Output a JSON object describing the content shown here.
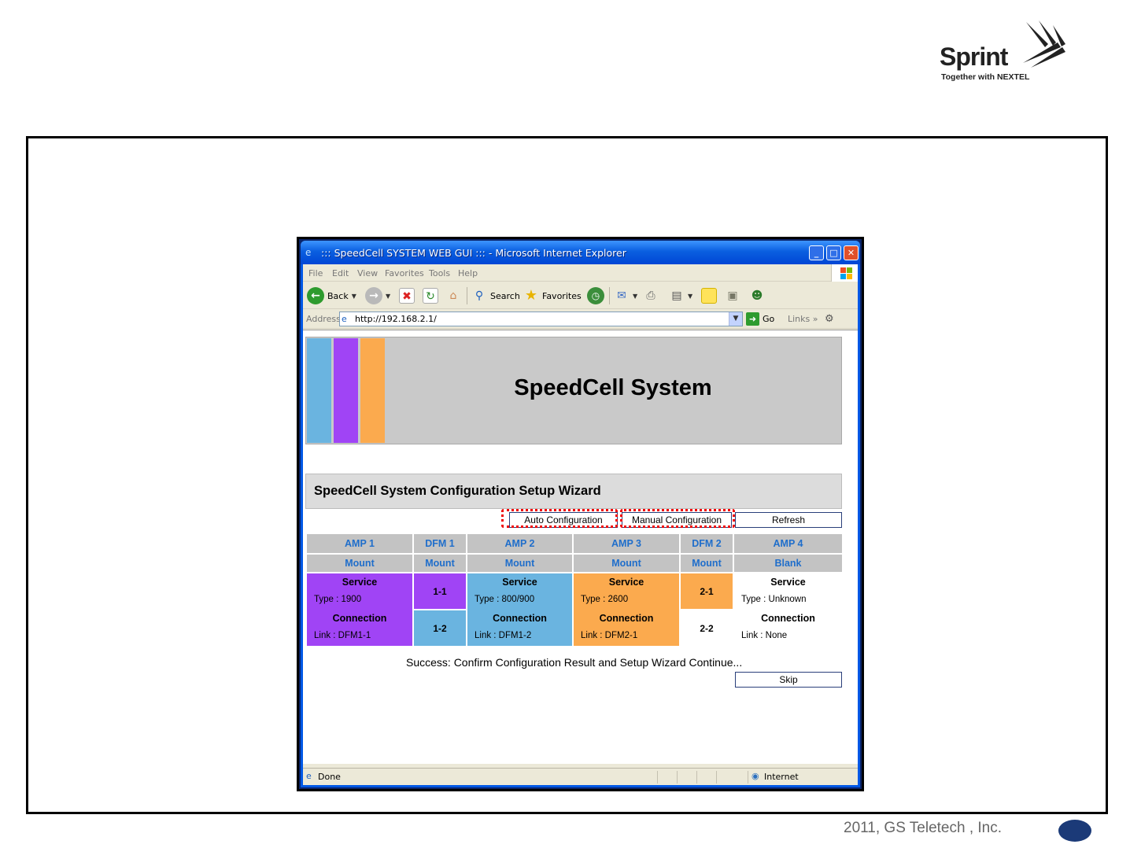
{
  "logo": {
    "brand": "Sprint",
    "tagline": "Together with NEXTEL"
  },
  "footer": {
    "copyright": "2011, GS Teletech , Inc."
  },
  "browser": {
    "title": "::: SpeedCell SYSTEM WEB GUI ::: - Microsoft Internet Explorer",
    "menu": [
      "File",
      "Edit",
      "View",
      "Favorites",
      "Tools",
      "Help"
    ],
    "toolbar": {
      "back": "Back",
      "search": "Search",
      "favorites": "Favorites"
    },
    "address_label": "Address",
    "url": "http://192.168.2.1/",
    "go": "Go",
    "links": "Links",
    "status_left": "Done",
    "status_zone": "Internet"
  },
  "page": {
    "banner_title": "SpeedCell System",
    "banner_colors": [
      "#6ab4e0",
      "#a044f5",
      "#fbaa4e"
    ],
    "wizard_title": "SpeedCell System Configuration Setup Wizard",
    "buttons": {
      "auto": "Auto Configuration",
      "manual": "Manual Configuration",
      "refresh": "Refresh",
      "skip": "Skip"
    },
    "columns": [
      {
        "name": "AMP 1",
        "state": "Mount"
      },
      {
        "name": "DFM 1",
        "state": "Mount"
      },
      {
        "name": "AMP 2",
        "state": "Mount"
      },
      {
        "name": "AMP 3",
        "state": "Mount"
      },
      {
        "name": "DFM 2",
        "state": "Mount"
      },
      {
        "name": "AMP 4",
        "state": "Blank"
      }
    ],
    "amps": {
      "amp1": {
        "service": "Service",
        "type": "Type : 1900",
        "connection": "Connection",
        "link": "Link : DFM1-1"
      },
      "amp2": {
        "service": "Service",
        "type": "Type : 800/900",
        "connection": "Connection",
        "link": "Link : DFM1-2"
      },
      "amp3": {
        "service": "Service",
        "type": "Type : 2600",
        "connection": "Connection",
        "link": "Link : DFM2-1"
      },
      "amp4": {
        "service": "Service",
        "type": "Type : Unknown",
        "connection": "Connection",
        "link": "Link : None"
      }
    },
    "dfm_ports": {
      "dfm1_top": "1-1",
      "dfm1_bottom": "1-2",
      "dfm2_top": "2-1",
      "dfm2_bottom": "2-2"
    },
    "success_message": "Success: Confirm Configuration Result and Setup Wizard Continue...",
    "colors": {
      "purple": "#a044f5",
      "blue": "#6ab4e0",
      "orange": "#fbaa4e",
      "header_text": "#1f6ecb"
    }
  }
}
